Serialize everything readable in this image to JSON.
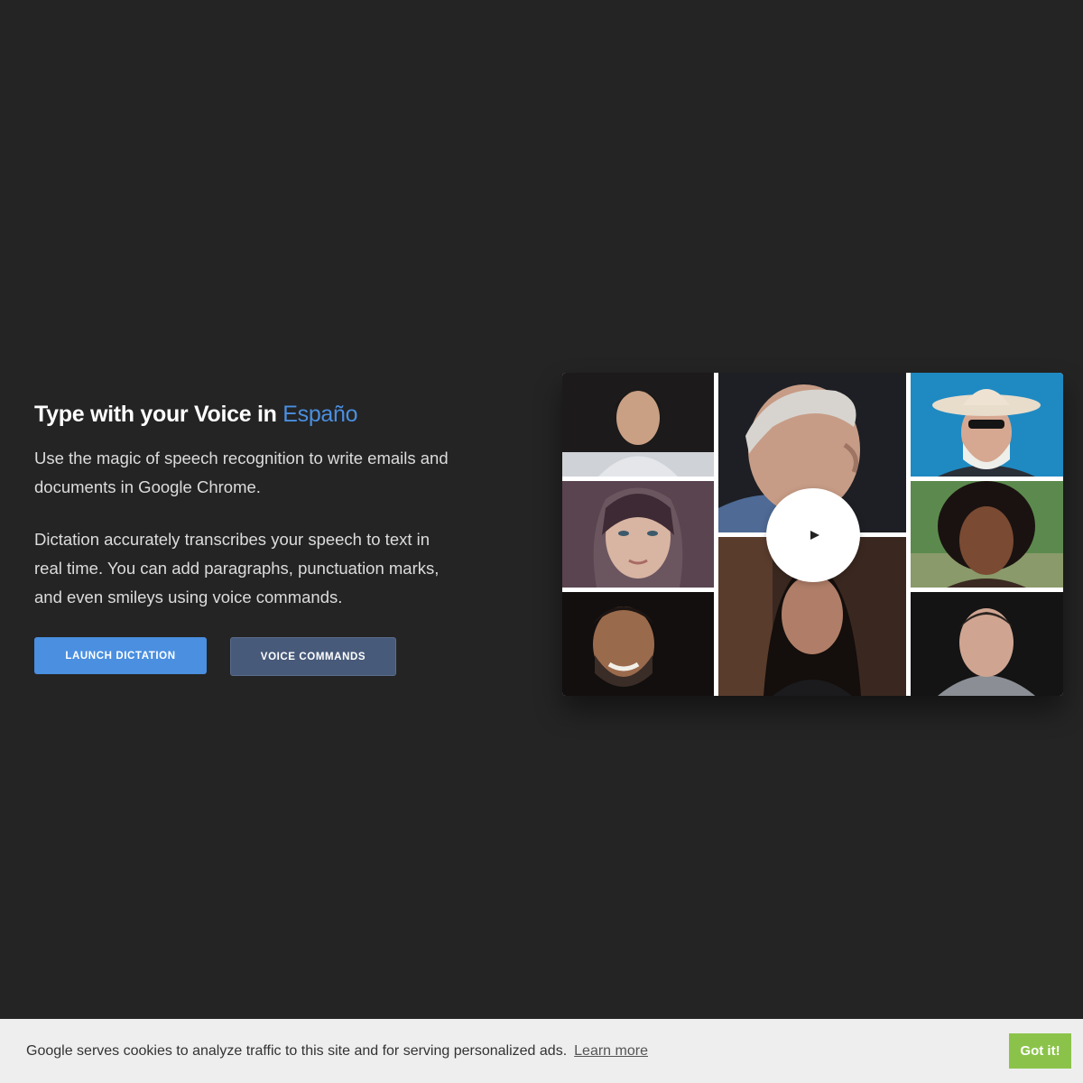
{
  "hero": {
    "headline_prefix": "Type with your Voice in ",
    "headline_language": "Españo",
    "paragraph_1": "Use the magic of speech recognition to write emails and documents in Google Chrome.",
    "paragraph_2": "Dictation accurately transcribes your speech to text in real time. You can add paragraphs, punctuation marks, and even smileys using voice commands.",
    "launch_button": "Launch Dictation",
    "voice_commands_button": "Voice Commands"
  },
  "video": {
    "play_icon": "play-icon"
  },
  "cookie_bar": {
    "message": "Google serves cookies to analyze traffic to this site and for serving personalized ads.",
    "learn_more": "Learn more",
    "accept_button": "Got it!"
  },
  "colors": {
    "background": "#242424",
    "accent_blue": "#4a8fe0",
    "secondary_button": "#485a7a",
    "cookie_accept": "#8bc34a"
  }
}
